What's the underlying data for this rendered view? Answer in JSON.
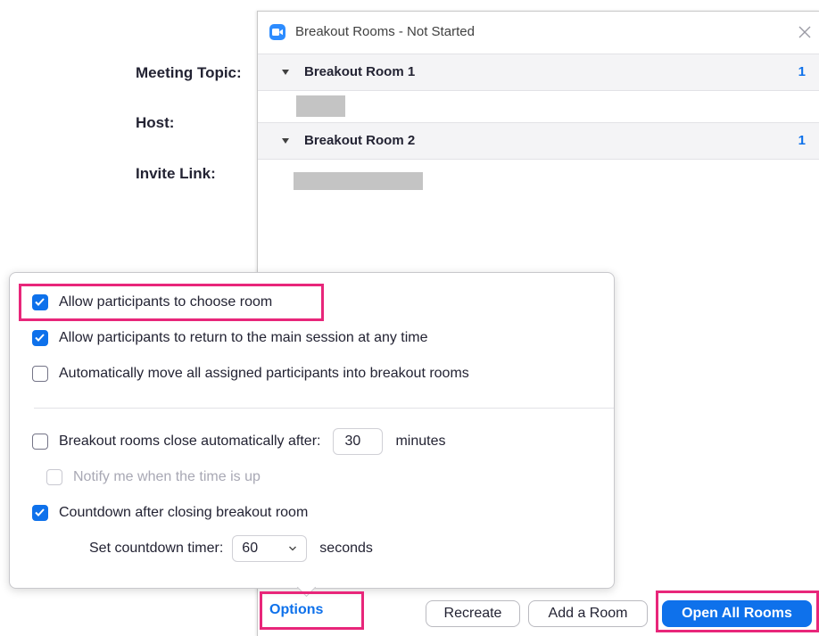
{
  "meeting_info": {
    "topic_label": "Meeting Topic:",
    "host_label": "Host:",
    "invite_label": "Invite Link:"
  },
  "breakout_window": {
    "title": "Breakout Rooms - Not Started",
    "rooms": [
      {
        "name": "Breakout Room 1",
        "count": "1"
      },
      {
        "name": "Breakout Room 2",
        "count": "1"
      }
    ]
  },
  "options_popover": {
    "allow_choose": {
      "label": "Allow participants to choose room",
      "checked": true
    },
    "allow_return": {
      "label": "Allow participants to return to the main session at any time",
      "checked": true
    },
    "auto_move": {
      "label": "Automatically move all assigned participants into breakout rooms",
      "checked": false
    },
    "auto_close": {
      "label": "Breakout rooms close automatically after:",
      "checked": false,
      "value": "30",
      "unit": "minutes"
    },
    "notify": {
      "label": "Notify me when the time is up",
      "checked": false,
      "disabled": true
    },
    "countdown": {
      "label": "Countdown after closing breakout room",
      "checked": true
    },
    "countdown_timer": {
      "label": "Set countdown timer:",
      "value": "60",
      "unit": "seconds"
    }
  },
  "bottom_bar": {
    "options_label": "Options",
    "recreate_label": "Recreate",
    "add_room_label": "Add a Room",
    "open_all_label": "Open All Rooms"
  },
  "colors": {
    "accent": "#0e71eb",
    "highlight": "#e8267a",
    "redacted": "#c4c4c4"
  },
  "icons": [
    "zoom-app-icon",
    "close-icon",
    "caret-down-icon",
    "checkmark-icon",
    "chevron-down-icon"
  ]
}
